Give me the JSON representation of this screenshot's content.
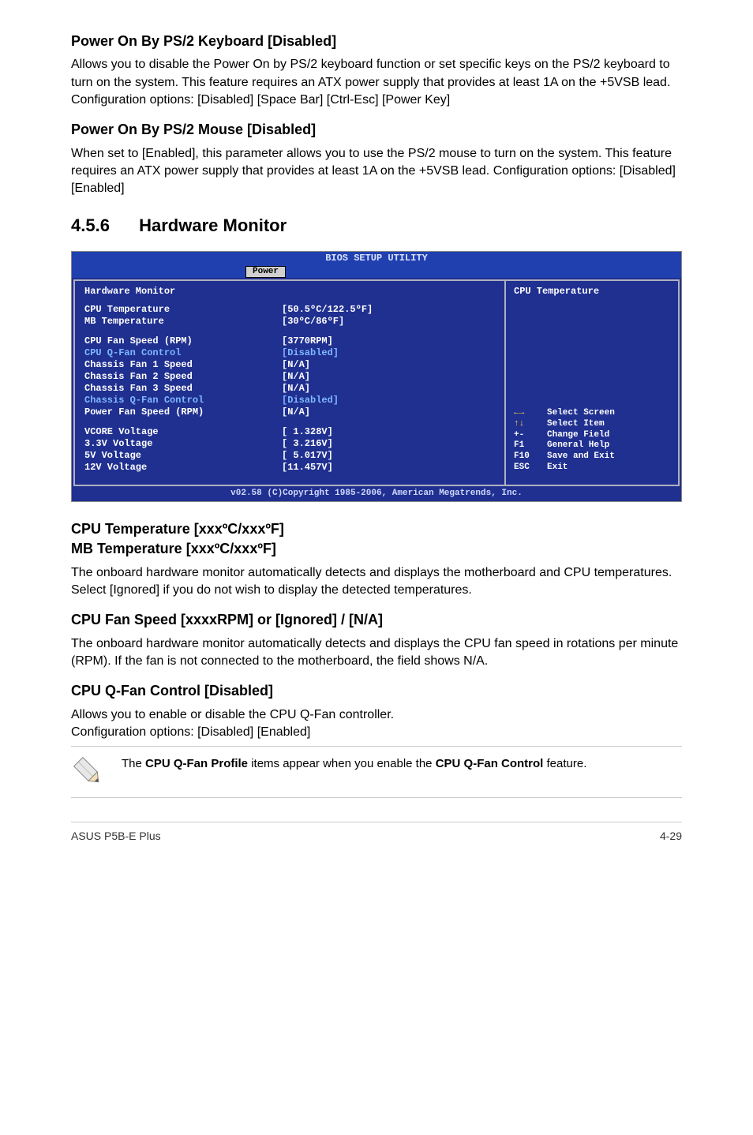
{
  "sections": {
    "s1": {
      "heading": "Power On By PS/2 Keyboard [Disabled]",
      "p1": "Allows you to disable the Power On by PS/2 keyboard function or set specific keys on the PS/2 keyboard to turn on the system. This feature requires an ATX power supply that provides at least 1A on the +5VSB lead.",
      "p2": "Configuration options: [Disabled] [Space Bar] [Ctrl-Esc] [Power Key]"
    },
    "s2": {
      "heading": "Power On By PS/2 Mouse [Disabled]",
      "p1": "When set to [Enabled], this parameter allows you to use the PS/2 mouse to turn on the system. This feature requires an ATX power supply that provides at least 1A on the +5VSB lead. Configuration options: [Disabled] [Enabled]"
    },
    "hw": {
      "num": "4.5.6",
      "title": "Hardware Monitor"
    },
    "s3": {
      "h_line1": "CPU Temperature [xxxºC/xxxºF]",
      "h_line2": "MB Temperature [xxxºC/xxxºF]",
      "p": "The onboard hardware monitor automatically detects and displays the motherboard and CPU temperatures. Select [Ignored] if you do not wish to display the detected temperatures."
    },
    "s4": {
      "heading": "CPU Fan Speed [xxxxRPM] or [Ignored] / [N/A]",
      "p": "The onboard hardware monitor automatically detects and displays the CPU fan speed in rotations per minute (RPM). If the fan is not connected to the motherboard, the field shows N/A."
    },
    "s5": {
      "heading": "CPU Q-Fan Control [Disabled]",
      "p1": "Allows you to enable or disable the CPU Q-Fan controller.",
      "p2": "Configuration options: [Disabled] [Enabled]"
    },
    "note": {
      "pre": "The ",
      "b1": "CPU Q-Fan Profile",
      "mid": " items appear when you enable the ",
      "b2": "CPU Q-Fan Control",
      "post": " feature."
    }
  },
  "bios": {
    "title": "BIOS SETUP UTILITY",
    "tab": "Power",
    "left_header": "Hardware Monitor",
    "rows": [
      {
        "label": "CPU Temperature",
        "val": "[50.5ºC/122.5ºF]",
        "hi": true
      },
      {
        "label": "MB Temperature",
        "val": "[30ºC/86ºF]",
        "hi": true
      }
    ],
    "rows2": [
      {
        "label": "CPU Fan Speed (RPM)",
        "val": "[3770RPM]",
        "hi": true
      },
      {
        "label": "CPU Q-Fan Control",
        "val": "[Disabled]",
        "hi": false
      },
      {
        "label": "Chassis Fan 1 Speed",
        "val": "[N/A]",
        "hi": true
      },
      {
        "label": "Chassis Fan 2 Speed",
        "val": "[N/A]",
        "hi": true
      },
      {
        "label": "Chassis Fan 3 Speed",
        "val": "[N/A]",
        "hi": true
      },
      {
        "label": "Chassis Q-Fan Control",
        "val": "[Disabled]",
        "hi": false
      },
      {
        "label": "Power Fan Speed (RPM)",
        "val": "[N/A]",
        "hi": true
      }
    ],
    "rows3": [
      {
        "label": "VCORE Voltage",
        "val": "[ 1.328V]",
        "hi": true
      },
      {
        "label": "3.3V Voltage",
        "val": "[ 3.216V]",
        "hi": true
      },
      {
        "label": "5V Voltage",
        "val": "[ 5.017V]",
        "hi": true
      },
      {
        "label": "12V Voltage",
        "val": "[11.457V]",
        "hi": true
      }
    ],
    "right_top": "CPU Temperature",
    "legend": [
      {
        "k": "←→",
        "t": "Select Screen",
        "yellow": true
      },
      {
        "k": "↑↓",
        "t": "Select Item",
        "yellow": true
      },
      {
        "k": "+-",
        "t": "Change Field",
        "yellow": false
      },
      {
        "k": "F1",
        "t": "General Help",
        "yellow": false
      },
      {
        "k": "F10",
        "t": "Save and Exit",
        "yellow": false
      },
      {
        "k": "ESC",
        "t": "Exit",
        "yellow": false
      }
    ],
    "footer": "v02.58 (C)Copyright 1985-2006, American Megatrends, Inc."
  },
  "footer": {
    "left": "ASUS P5B-E Plus",
    "right": "4-29"
  }
}
